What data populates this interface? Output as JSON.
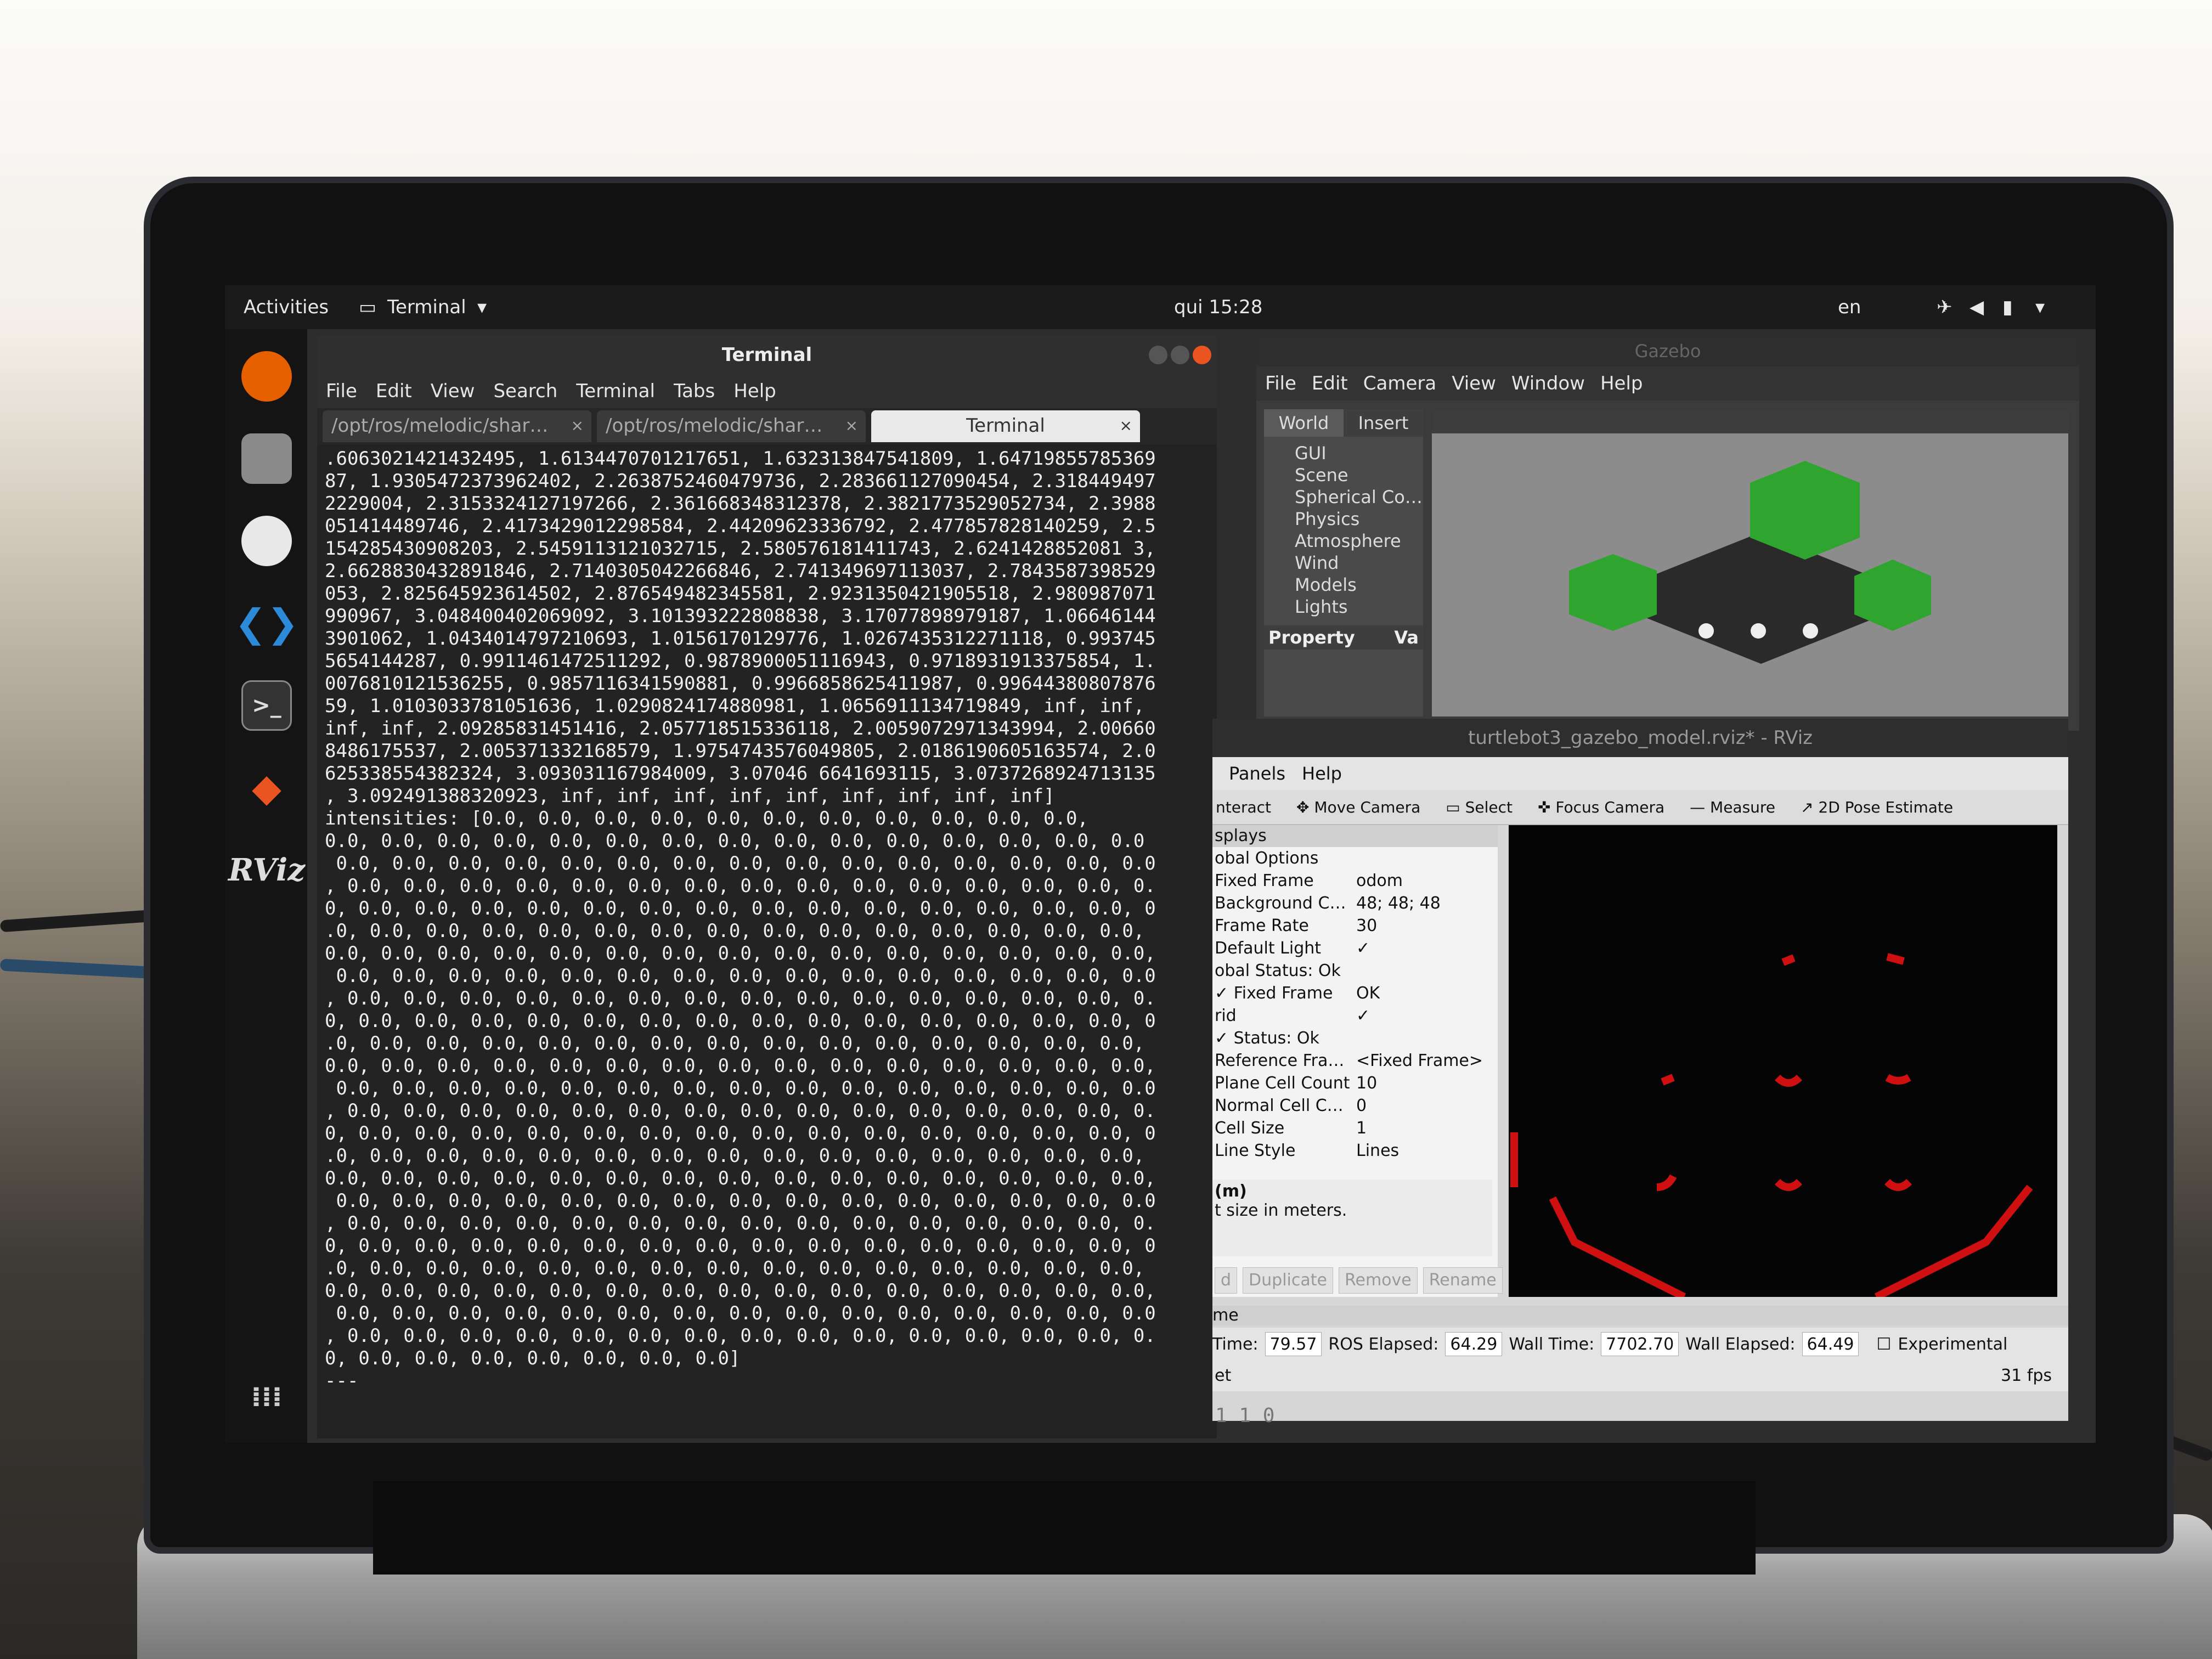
{
  "topbar": {
    "activities": "Activities",
    "app_menu": "Terminal",
    "clock": "qui 15:28",
    "lang": "en"
  },
  "dock": {
    "rviz_label": "RViz"
  },
  "terminal": {
    "title": "Terminal",
    "menu": [
      "File",
      "Edit",
      "View",
      "Search",
      "Terminal",
      "Tabs",
      "Help"
    ],
    "tabs": [
      "/opt/ros/melodic/shar…",
      "/opt/ros/melodic/shar…",
      "Terminal"
    ],
    "lines": [
      ".6063021421432495, 1.6134470701217651, 1.632313847541809, 1.64719855785369",
      "87, 1.9305472373962402, 2.2638752460479736, 2.283661127090454, 2.318449497",
      "2229004, 2.3153324127197266, 2.361668348312378, 2.3821773529052734, 2.3988",
      "051414489746, 2.4173429012298584, 2.44209623336792, 2.477857828140259, 2.5",
      "154285430908203, 2.5459113121032715, 2.580576181411743, 2.6241428852081 3,",
      "2.6628830432891846, 2.7140305042266846, 2.741349697113037, 2.7843587398529",
      "053, 2.825645923614502, 2.876549482345581, 2.9231350421905518, 2.980987071",
      "990967, 3.048400402069092, 3.101393222808838, 3.17077898979187, 1.06646144",
      "3901062, 1.0434014797210693, 1.0156170129776, 1.0267435312271118, 0.993745",
      "5654144287, 0.9911461472511292, 0.9878900051116943, 0.9718931913375854, 1.",
      "0076810121536255, 0.9857116341590881, 0.9966858625411987, 0.99644380807876",
      "59, 1.0103033781051636, 1.0290824174880981, 1.0656911134719849, inf, inf,",
      "inf, inf, 2.09285831451416, 2.057718515336118, 2.0059072971343994, 2.00660",
      "8486175537, 2.005371332168579, 1.9754743576049805, 2.0186190605163574, 2.0",
      "625338554382324, 3.093031167984009, 3.07046 6641693115, 3.0737268924713135",
      ", 3.092491388320923, inf, inf, inf, inf, inf, inf, inf, inf, inf]",
      "intensities: [0.0, 0.0, 0.0, 0.0, 0.0, 0.0, 0.0, 0.0, 0.0, 0.0, 0.0,",
      "0.0, 0.0, 0.0, 0.0, 0.0, 0.0, 0.0, 0.0, 0.0, 0.0, 0.0, 0.0, 0.0, 0.0, 0.0",
      " 0.0, 0.0, 0.0, 0.0, 0.0, 0.0, 0.0, 0.0, 0.0, 0.0, 0.0, 0.0, 0.0, 0.0, 0.0",
      ", 0.0, 0.0, 0.0, 0.0, 0.0, 0.0, 0.0, 0.0, 0.0, 0.0, 0.0, 0.0, 0.0, 0.0, 0.",
      "0, 0.0, 0.0, 0.0, 0.0, 0.0, 0.0, 0.0, 0.0, 0.0, 0.0, 0.0, 0.0, 0.0, 0.0, 0",
      ".0, 0.0, 0.0, 0.0, 0.0, 0.0, 0.0, 0.0, 0.0, 0.0, 0.0, 0.0, 0.0, 0.0, 0.0,",
      "0.0, 0.0, 0.0, 0.0, 0.0, 0.0, 0.0, 0.0, 0.0, 0.0, 0.0, 0.0, 0.0, 0.0, 0.0,",
      " 0.0, 0.0, 0.0, 0.0, 0.0, 0.0, 0.0, 0.0, 0.0, 0.0, 0.0, 0.0, 0.0, 0.0, 0.0",
      ", 0.0, 0.0, 0.0, 0.0, 0.0, 0.0, 0.0, 0.0, 0.0, 0.0, 0.0, 0.0, 0.0, 0.0, 0.",
      "0, 0.0, 0.0, 0.0, 0.0, 0.0, 0.0, 0.0, 0.0, 0.0, 0.0, 0.0, 0.0, 0.0, 0.0, 0",
      ".0, 0.0, 0.0, 0.0, 0.0, 0.0, 0.0, 0.0, 0.0, 0.0, 0.0, 0.0, 0.0, 0.0, 0.0,",
      "0.0, 0.0, 0.0, 0.0, 0.0, 0.0, 0.0, 0.0, 0.0, 0.0, 0.0, 0.0, 0.0, 0.0, 0.0,",
      " 0.0, 0.0, 0.0, 0.0, 0.0, 0.0, 0.0, 0.0, 0.0, 0.0, 0.0, 0.0, 0.0, 0.0, 0.0",
      ", 0.0, 0.0, 0.0, 0.0, 0.0, 0.0, 0.0, 0.0, 0.0, 0.0, 0.0, 0.0, 0.0, 0.0, 0.",
      "0, 0.0, 0.0, 0.0, 0.0, 0.0, 0.0, 0.0, 0.0, 0.0, 0.0, 0.0, 0.0, 0.0, 0.0, 0",
      ".0, 0.0, 0.0, 0.0, 0.0, 0.0, 0.0, 0.0, 0.0, 0.0, 0.0, 0.0, 0.0, 0.0, 0.0,",
      "0.0, 0.0, 0.0, 0.0, 0.0, 0.0, 0.0, 0.0, 0.0, 0.0, 0.0, 0.0, 0.0, 0.0, 0.0,",
      " 0.0, 0.0, 0.0, 0.0, 0.0, 0.0, 0.0, 0.0, 0.0, 0.0, 0.0, 0.0, 0.0, 0.0, 0.0",
      ", 0.0, 0.0, 0.0, 0.0, 0.0, 0.0, 0.0, 0.0, 0.0, 0.0, 0.0, 0.0, 0.0, 0.0, 0.",
      "0, 0.0, 0.0, 0.0, 0.0, 0.0, 0.0, 0.0, 0.0, 0.0, 0.0, 0.0, 0.0, 0.0, 0.0, 0",
      ".0, 0.0, 0.0, 0.0, 0.0, 0.0, 0.0, 0.0, 0.0, 0.0, 0.0, 0.0, 0.0, 0.0, 0.0,",
      "0.0, 0.0, 0.0, 0.0, 0.0, 0.0, 0.0, 0.0, 0.0, 0.0, 0.0, 0.0, 0.0, 0.0, 0.0,",
      " 0.0, 0.0, 0.0, 0.0, 0.0, 0.0, 0.0, 0.0, 0.0, 0.0, 0.0, 0.0, 0.0, 0.0, 0.0",
      ", 0.0, 0.0, 0.0, 0.0, 0.0, 0.0, 0.0, 0.0, 0.0, 0.0, 0.0, 0.0, 0.0, 0.0, 0.",
      "0, 0.0, 0.0, 0.0, 0.0, 0.0, 0.0, 0.0]",
      "---"
    ]
  },
  "gazebo": {
    "title": "Gazebo",
    "menu": [
      "File",
      "Edit",
      "Camera",
      "View",
      "Window",
      "Help"
    ],
    "tabs": [
      "World",
      "Insert"
    ],
    "tree": [
      "GUI",
      "Scene",
      "Spherical Co…",
      "Physics",
      "Atmosphere",
      "Wind",
      "Models",
      "Lights"
    ],
    "property_header": "Property",
    "value_header": "Va"
  },
  "rviz": {
    "title": "turtlebot3_gazebo_model.rviz* - RViz",
    "menu": [
      "Panels",
      "Help"
    ],
    "tools": [
      "nteract",
      "Move Camera",
      "Select",
      "Focus Camera",
      "Measure",
      "2D Pose Estimate"
    ],
    "displays_title": "splays",
    "props": [
      {
        "k": "obal Options",
        "v": ""
      },
      {
        "k": "Fixed Frame",
        "v": "odom"
      },
      {
        "k": "Background C…",
        "v": "48; 48; 48"
      },
      {
        "k": "Frame Rate",
        "v": "30"
      },
      {
        "k": "Default Light",
        "v": "✓"
      },
      {
        "k": "obal Status: Ok",
        "v": ""
      },
      {
        "k": "✓ Fixed Frame",
        "v": "OK"
      },
      {
        "k": "rid",
        "v": "✓"
      },
      {
        "k": "✓ Status: Ok",
        "v": ""
      },
      {
        "k": "Reference Fra…",
        "v": "<Fixed Frame>"
      },
      {
        "k": "Plane Cell Count",
        "v": "10"
      },
      {
        "k": "Normal Cell C…",
        "v": "0"
      },
      {
        "k": "Cell Size",
        "v": "1"
      },
      {
        "k": "Line Style",
        "v": "Lines"
      }
    ],
    "desc_title": "(m)",
    "desc_text": "t size in meters.",
    "buttons": [
      "d",
      "Duplicate",
      "Remove",
      "Rename"
    ],
    "time_head": "me",
    "ros_time_label": "Time:",
    "ros_time": "79.57",
    "ros_elapsed_label": "ROS Elapsed:",
    "ros_elapsed": "64.29",
    "wall_time_label": "Wall Time:",
    "wall_time": "7702.70",
    "wall_elapsed_label": "Wall Elapsed:",
    "wall_elapsed": "64.49",
    "experimental": "Experimental",
    "reset": "et",
    "fps": "31 fps",
    "below_text": "1 1 0"
  },
  "colors": {
    "accent": "#e95420",
    "grid_red": "#d01010",
    "gazebo_green": "#2fa52f"
  }
}
